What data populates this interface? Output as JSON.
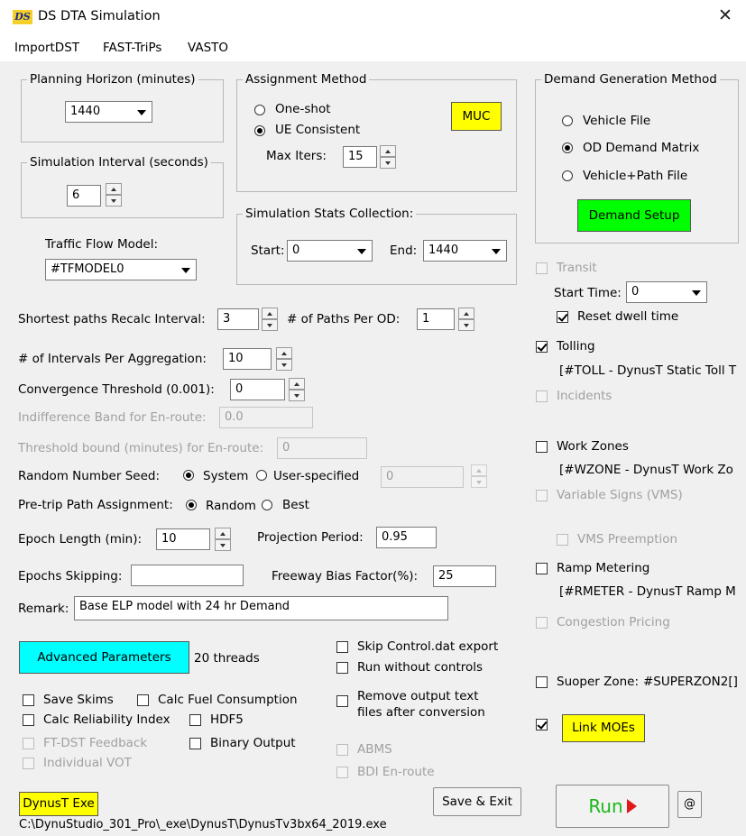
{
  "window": {
    "title": "DS DTA Simulation",
    "logo_text": "DS",
    "close_glyph": "✕"
  },
  "menu": [
    "ImportDST",
    "FAST-TriPs",
    "VASTO"
  ],
  "planning_horizon": {
    "legend": "Planning Horizon (minutes)",
    "value": "1440"
  },
  "simulation_interval": {
    "legend": "Simulation Interval (seconds)",
    "value": "6"
  },
  "traffic_flow": {
    "label": "Traffic Flow Model:",
    "value": "#TFMODEL0"
  },
  "assignment": {
    "legend": "Assignment Method",
    "one_shot": "One-shot",
    "ue_consistent": "UE Consistent",
    "selected": "UE Consistent",
    "max_iters_label": "Max Iters:",
    "max_iters_value": "15",
    "muc_button": "MUC"
  },
  "stats": {
    "legend": "Simulation Stats Collection:",
    "start_label": "Start:",
    "start_value": "0",
    "end_label": "End:",
    "end_value": "1440"
  },
  "demand": {
    "legend": "Demand Generation Method",
    "options": [
      "Vehicle File",
      "OD Demand Matrix",
      "Vehicle+Path File"
    ],
    "selected": "OD Demand Matrix",
    "setup_button": "Demand Setup"
  },
  "transit": {
    "label": "Transit",
    "start_time_label": "Start Time:",
    "start_time_value": "0",
    "reset_dwell_label": "Reset dwell time"
  },
  "tolling": {
    "label": "Tolling",
    "detail": "[#TOLL - DynusT Static Toll T"
  },
  "incidents": {
    "label": "Incidents"
  },
  "work_zones": {
    "label": "Work Zones",
    "detail": "[#WZONE - DynusT Work Zo"
  },
  "vms": {
    "label": "Variable Signs (VMS)",
    "preemption_label": "VMS Preemption"
  },
  "ramp_metering": {
    "label": "Ramp Metering",
    "detail": "[#RMETER - DynusT Ramp M"
  },
  "congestion_pricing": {
    "label": "Congestion Pricing"
  },
  "super_zone": {
    "label": "Suoper Zone:",
    "value": "#SUPERZON2[]"
  },
  "link_moes_button": "Link MOEs",
  "params": {
    "sp_recalc_label": "Shortest paths Recalc Interval:",
    "sp_recalc_value": "3",
    "paths_per_od_label": "# of Paths Per OD:",
    "paths_per_od_value": "1",
    "intervals_agg_label": "# of Intervals Per Aggregation:",
    "intervals_agg_value": "10",
    "convergence_label": "Convergence Threshold (0.001):",
    "convergence_value": "0",
    "indifference_label": "Indifference Band for En-route:",
    "indifference_value": "0.0",
    "threshold_bound_label": "Threshold bound (minutes) for En-route:",
    "threshold_bound_value": "0",
    "seed_label": "Random Number Seed:",
    "seed_system": "System",
    "seed_user": "User-specified",
    "seed_value": "0",
    "pretrip_label": "Pre-trip Path Assignment:",
    "pretrip_random": "Random",
    "pretrip_best": "Best",
    "epoch_label": "Epoch Length (min):",
    "epoch_value": "10",
    "projection_label": "Projection Period:",
    "projection_value": "0.95",
    "epochs_skip_label": "Epochs Skipping:",
    "epochs_skip_value": "",
    "freeway_bias_label": "Freeway Bias Factor(%):",
    "freeway_bias_value": "25",
    "remark_label": "Remark:",
    "remark_value": "Base ELP model with 24 hr Demand"
  },
  "advanced_button": "Advanced Parameters",
  "threads_text": "20 threads",
  "options": {
    "skip_control": "Skip Control.dat export",
    "run_without_controls": "Run without controls",
    "remove_output_1": "Remove output text",
    "remove_output_2": "files after conversion",
    "abms": "ABMS",
    "bdi": "BDI En-route",
    "save_skims": "Save Skims",
    "calc_fuel": "Calc Fuel Consumption",
    "calc_reliability": "Calc Reliability Index",
    "hdf5": "HDF5",
    "ft_dst": "FT-DST Feedback",
    "binary_output": "Binary Output",
    "individual_vot": "Individual VOT"
  },
  "dynust_exe_button": "DynusT Exe",
  "save_exit_button": "Save & Exit",
  "run_button": "Run",
  "at_button": "@",
  "exe_path": "C:\\DynuStudio_301_Pro\\_exe\\DynusT\\DynusTv3bx64_2019.exe",
  "colors": {
    "yellow": "#ffff00",
    "green": "#00ff00",
    "cyan": "#00ffff",
    "run_text": "#18b818",
    "run_arrow": "#e01818"
  }
}
